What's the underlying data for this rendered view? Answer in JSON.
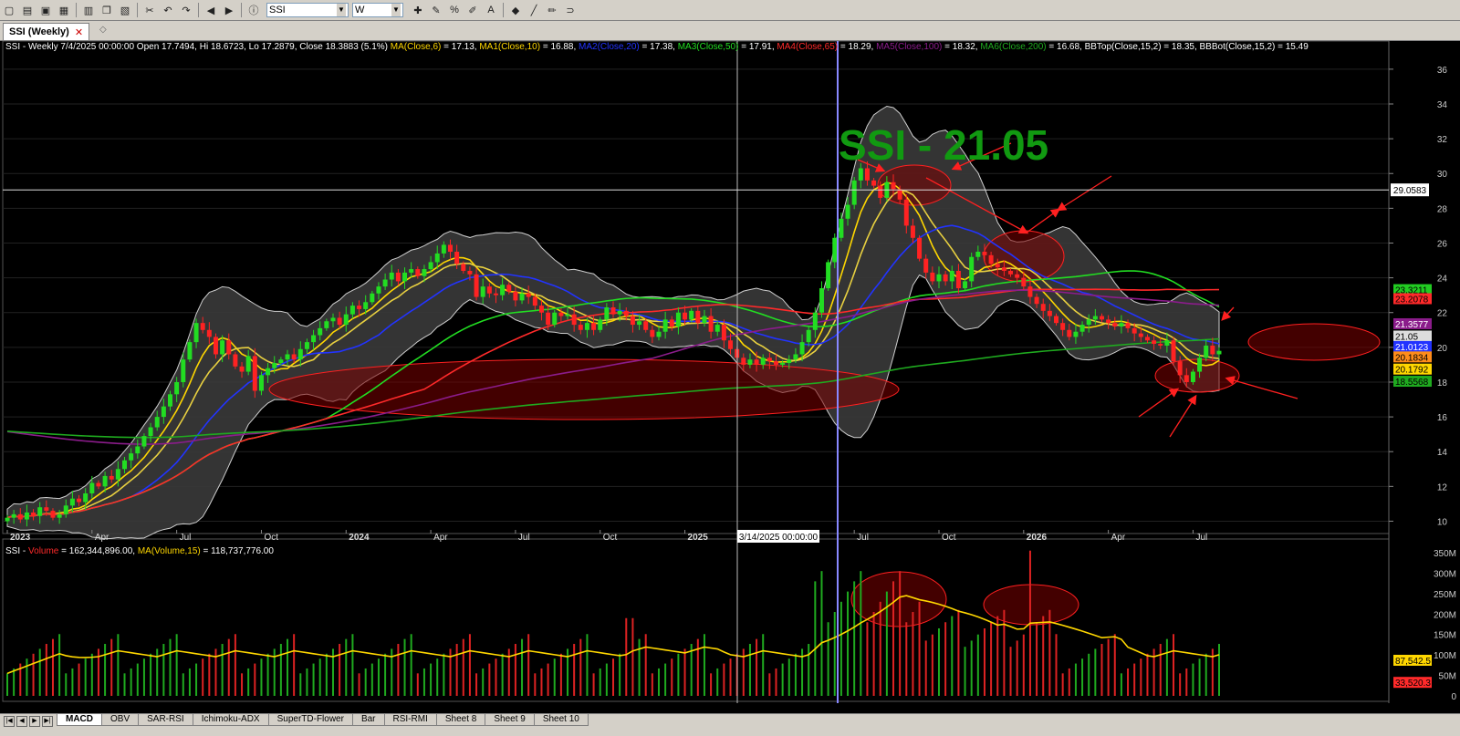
{
  "toolbar": {
    "symbol_value": "SSI",
    "period_value": "W",
    "icons": [
      "new-icon",
      "open-icon",
      "save-icon",
      "save-all-icon",
      "print-icon",
      "copy-icon",
      "paste-icon",
      "cut-icon",
      "undo-icon",
      "redo-icon",
      "back-icon",
      "forward-icon",
      "info-icon",
      "crosshair-icon",
      "draw-icon",
      "fib-icon",
      "pen-icon",
      "text-icon",
      "color-icon",
      "line-icon",
      "brush-icon",
      "magnet-icon"
    ]
  },
  "doc_tab": {
    "label": "SSI (Weekly)",
    "close": "✕",
    "add": "◇"
  },
  "price_header": {
    "info": "SSI - Weekly 7/4/2025 00:00:00 Open 17.7494, Hi 18.6723, Lo 17.2879, Close 18.3883 (5.1%)",
    "ma_items": [
      {
        "name": "MA(Close,6)",
        "value": " = 17.13, ",
        "color": "#ffd700"
      },
      {
        "name": "MA1(Close,10)",
        "value": " = 16.88, ",
        "color": "#ffd700"
      },
      {
        "name": "MA2(Close,20)",
        "value": " = 17.38, ",
        "color": "#2233ff"
      },
      {
        "name": "MA3(Close,50)",
        "value": " = 17.91, ",
        "color": "#22dd22"
      },
      {
        "name": "MA4(Close,65)",
        "value": " = 18.29, ",
        "color": "#ff2a2a"
      },
      {
        "name": "MA5(Close,100)",
        "value": " = 18.32, ",
        "color": "#8b1c8b"
      },
      {
        "name": "MA6(Close,200)",
        "value": " = 16.68, ",
        "color": "#1faa1f"
      },
      {
        "name": "BBTop(Close,15,2)",
        "value": " = 18.35, ",
        "color": "#ffffff"
      },
      {
        "name": "BBBot(Close,15,2)",
        "value": " = 15.49",
        "color": "#ffffff"
      }
    ]
  },
  "volume_header": {
    "prefix": "SSI - ",
    "vol_name": "Volume",
    "vol_value": " = 162,344,896.00, ",
    "ma_name": "MA(Volume,15)",
    "ma_value": " = 118,737,776.00"
  },
  "annotation_text": "SSI - 21.05",
  "crosshair": {
    "date_label": "3/14/2025 00:00:00",
    "price_label": "29.0583",
    "price": 29.0583
  },
  "price_axis_ticks": [
    {
      "v": 36,
      "label": "36"
    },
    {
      "v": 34,
      "label": "34"
    },
    {
      "v": 32,
      "label": "32"
    },
    {
      "v": 30,
      "label": "30"
    },
    {
      "v": 28,
      "label": "28"
    },
    {
      "v": 26,
      "label": "26"
    },
    {
      "v": 24,
      "label": "24"
    },
    {
      "v": 22,
      "label": "22"
    },
    {
      "v": 20,
      "label": "20"
    },
    {
      "v": 18,
      "label": "18"
    },
    {
      "v": 16,
      "label": "16"
    },
    {
      "v": 14,
      "label": "14"
    },
    {
      "v": 12,
      "label": "12"
    },
    {
      "v": 10,
      "label": "10"
    }
  ],
  "volume_axis_ticks": [
    {
      "v": 350,
      "label": "350M"
    },
    {
      "v": 300,
      "label": "300M"
    },
    {
      "v": 250,
      "label": "250M"
    },
    {
      "v": 200,
      "label": "200M"
    },
    {
      "v": 150,
      "label": "150M"
    },
    {
      "v": 100,
      "label": "100M"
    },
    {
      "v": 50,
      "label": "50M"
    },
    {
      "v": 0,
      "label": "0"
    }
  ],
  "price_badges": [
    {
      "label": "23.3211",
      "v": 23.3211,
      "bg": "#22cc22",
      "fg": "#000"
    },
    {
      "label": "23.2078",
      "v": 22.8,
      "bg": "#ff2a2a",
      "fg": "#000"
    },
    {
      "label": "21.3577",
      "v": 21.3577,
      "bg": "#8b1c8b",
      "fg": "#fff"
    },
    {
      "label": "21.05",
      "v": 20.65,
      "bg": "#dddddd",
      "fg": "#000"
    },
    {
      "label": "21.0123",
      "v": 20.05,
      "bg": "#2233ff",
      "fg": "#fff"
    },
    {
      "label": "20.1834",
      "v": 19.45,
      "bg": "#ff8c1a",
      "fg": "#000"
    },
    {
      "label": "20.1792",
      "v": 18.75,
      "bg": "#ffd700",
      "fg": "#000"
    },
    {
      "label": "18.5568",
      "v": 18.05,
      "bg": "#1faa1f",
      "fg": "#000"
    }
  ],
  "volume_badges": [
    {
      "label": "87,542.5",
      "v": 87,
      "bg": "#ffd700",
      "fg": "#000"
    },
    {
      "label": "33,520.3",
      "v": 33,
      "bg": "#ff2a2a",
      "fg": "#000"
    }
  ],
  "x_axis_labels": [
    {
      "t": 0,
      "label": "2023",
      "bold": true
    },
    {
      "t": 13,
      "label": "Apr",
      "bold": false
    },
    {
      "t": 26,
      "label": "Jul",
      "bold": false
    },
    {
      "t": 39,
      "label": "Oct",
      "bold": false
    },
    {
      "t": 52,
      "label": "2024",
      "bold": true
    },
    {
      "t": 65,
      "label": "Apr",
      "bold": false
    },
    {
      "t": 78,
      "label": "Jul",
      "bold": false
    },
    {
      "t": 91,
      "label": "Oct",
      "bold": false
    },
    {
      "t": 104,
      "label": "2025",
      "bold": true
    },
    {
      "t": 130,
      "label": "Jul",
      "bold": false
    },
    {
      "t": 143,
      "label": "Oct",
      "bold": false
    },
    {
      "t": 156,
      "label": "2026",
      "bold": true
    },
    {
      "t": 169,
      "label": "Apr",
      "bold": false
    },
    {
      "t": 182,
      "label": "Jul",
      "bold": false
    }
  ],
  "sheets": [
    "MACD",
    "OBV",
    "SAR-RSI",
    "Ichimoku-ADX",
    "SuperTD-Flower",
    "Bar",
    "RSI-RMI",
    "Sheet 8",
    "Sheet 9",
    "Sheet 10"
  ],
  "active_sheet": "MACD",
  "chart_data": {
    "type": "candlestick",
    "xlabel": "",
    "ylabel": "",
    "ylim": [
      9.5,
      37.2
    ],
    "volume_ylim": [
      0,
      370
    ],
    "closes": [
      10.2,
      10.4,
      10.1,
      10.5,
      10.3,
      10.8,
      10.6,
      10.2,
      10.4,
      10.9,
      11.3,
      11.1,
      11.6,
      12.2,
      12.0,
      12.6,
      12.4,
      13.0,
      13.5,
      13.9,
      14.3,
      14.9,
      15.4,
      16.0,
      16.6,
      17.3,
      18.0,
      19.3,
      20.3,
      21.4,
      21.0,
      20.6,
      19.6,
      20.4,
      19.6,
      18.9,
      18.6,
      19.5,
      17.5,
      18.4,
      18.8,
      19.1,
      19.3,
      19.6,
      19.3,
      19.9,
      20.3,
      20.7,
      21.1,
      21.5,
      21.7,
      21.3,
      21.9,
      22.4,
      22.2,
      22.6,
      23.1,
      23.5,
      23.9,
      24.3,
      23.8,
      24.3,
      24.5,
      24.1,
      24.5,
      24.9,
      25.4,
      25.9,
      25.5,
      24.8,
      24.4,
      24.2,
      22.9,
      23.5,
      23.1,
      23.0,
      23.6,
      23.2,
      22.7,
      23.1,
      22.9,
      22.4,
      22.0,
      21.3,
      22.0,
      21.8,
      21.9,
      21.3,
      21.0,
      21.4,
      21.0,
      21.6,
      22.3,
      21.9,
      22.1,
      21.8,
      21.3,
      21.5,
      21.0,
      20.6,
      20.9,
      21.6,
      21.2,
      22.0,
      21.6,
      22.1,
      21.4,
      21.8,
      20.9,
      21.3,
      20.4,
      19.9,
      19.4,
      19.0,
      19.3,
      19.0,
      19.4,
      19.2,
      19.0,
      19.1,
      19.3,
      19.6,
      20.3,
      21.0,
      22.0,
      23.4,
      24.9,
      26.3,
      27.4,
      28.2,
      29.6,
      30.3,
      29.6,
      29.3,
      28.6,
      29.5,
      29.1,
      28.5,
      27.0,
      26.3,
      25.1,
      24.3,
      23.8,
      24.2,
      23.8,
      24.4,
      23.4,
      23.8,
      25.2,
      25.5,
      25.3,
      24.8,
      24.6,
      24.4,
      24.2,
      24.0,
      23.5,
      22.9,
      22.5,
      22.1,
      21.8,
      21.4,
      21.0,
      20.6,
      20.9,
      21.3,
      21.6,
      21.8,
      21.6,
      21.4,
      21.2,
      21.4,
      21.1,
      20.8,
      20.6,
      20.4,
      20.2,
      20.1,
      20.4,
      19.2,
      18.4,
      18.0,
      18.6,
      19.4,
      20.1,
      19.6,
      19.8
    ],
    "ma_series": [
      {
        "name": "MA(Close,6)",
        "color": "#ffd700",
        "period": 6
      },
      {
        "name": "MA1(Close,10)",
        "color": "#e8d040",
        "period": 10
      },
      {
        "name": "MA2(Close,20)",
        "color": "#2233ff",
        "period": 20
      },
      {
        "name": "MA3(Close,50)",
        "color": "#22dd22",
        "period": 50
      },
      {
        "name": "MA4(Close,65)",
        "color": "#ff2a2a",
        "period": 65
      },
      {
        "name": "MA5(Close,100)",
        "color": "#8b1c8b",
        "period": 100
      },
      {
        "name": "MA6(Close,200)",
        "color": "#1faa1f",
        "period": 200
      }
    ],
    "bollinger": {
      "name": "BB(Close,15,2)",
      "period": 15,
      "k": 2
    },
    "volume_ma_period": 15
  }
}
